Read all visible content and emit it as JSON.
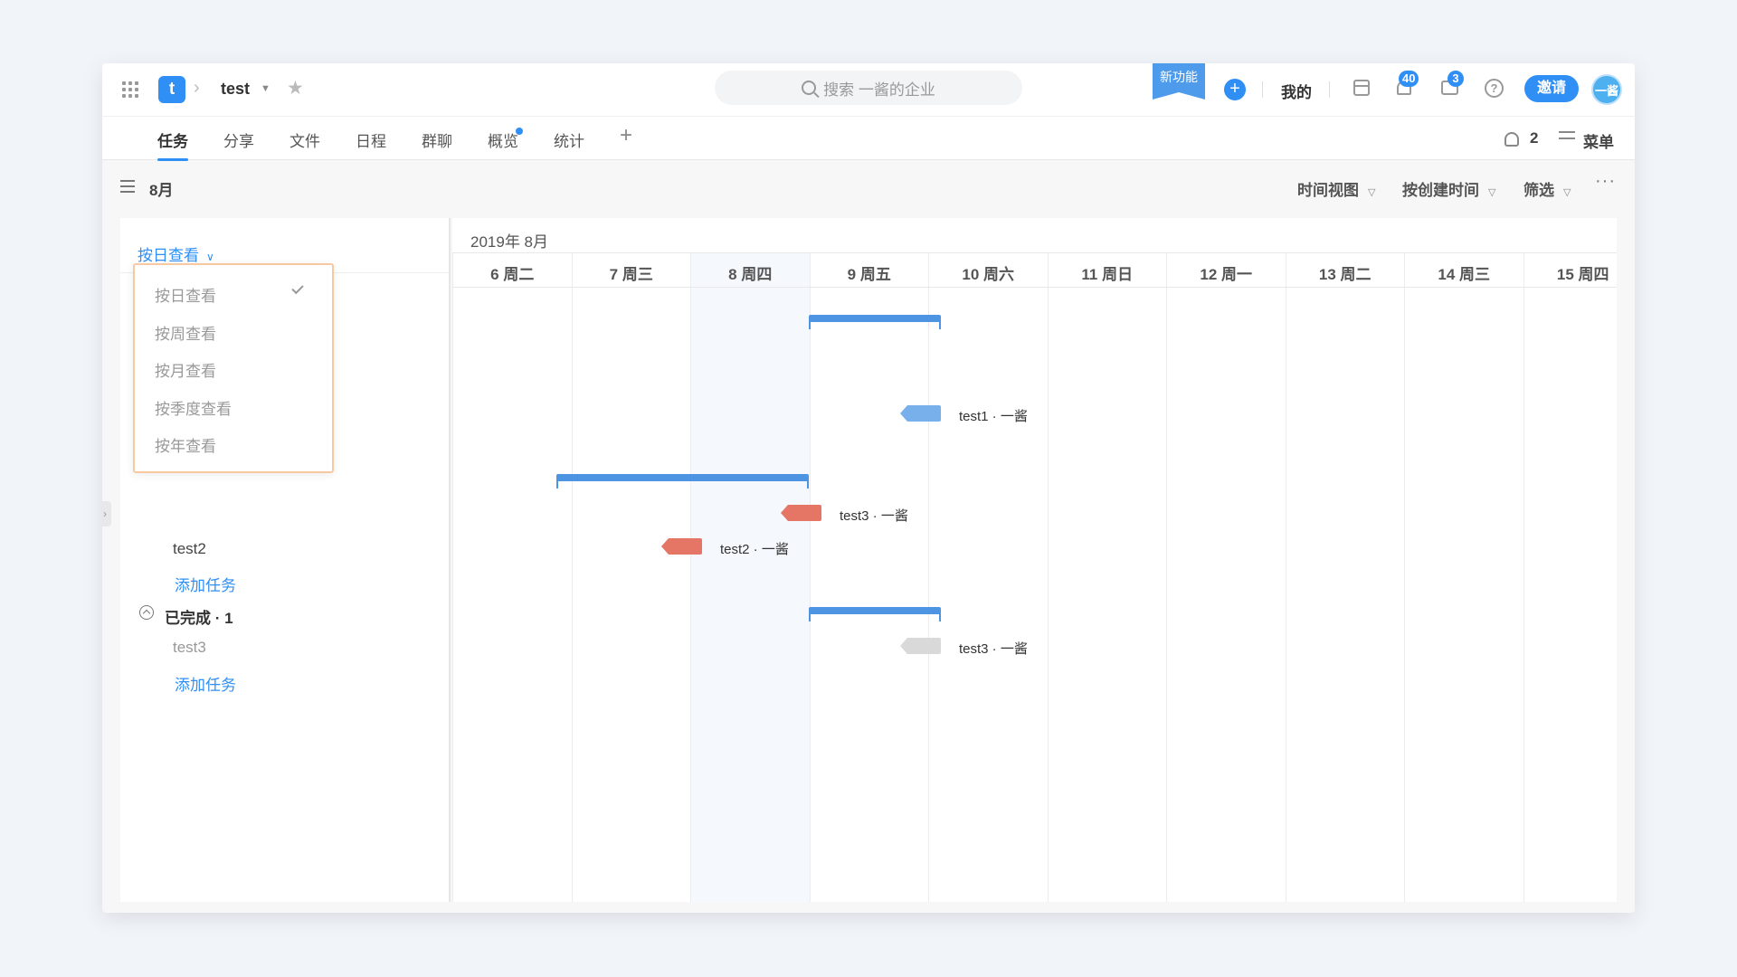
{
  "header": {
    "project_title": "test",
    "search_placeholder": "搜索 一酱的企业",
    "new_feature": "新功能",
    "mine": "我的",
    "bell_badge": "40",
    "msg_badge": "3",
    "help": "?",
    "invite": "邀请",
    "avatar": "一酱",
    "accent": "#2f8ff5"
  },
  "tabs": [
    {
      "label": "任务"
    },
    {
      "label": "分享"
    },
    {
      "label": "文件"
    },
    {
      "label": "日程"
    },
    {
      "label": "群聊"
    },
    {
      "label": "概览"
    },
    {
      "label": "统计"
    }
  ],
  "tab_right": {
    "member_count": "2",
    "menu": "菜单"
  },
  "toolbar": {
    "month": "8月",
    "time_view": "时间视图",
    "sort": "按创建时间",
    "filter": "筛选",
    "more": "···"
  },
  "left": {
    "view_toggle": "按日查看",
    "dropdown": [
      "按日查看",
      "按周查看",
      "按月查看",
      "按季度查看",
      "按年查看"
    ],
    "task_test2": "test2",
    "add_task_1": "添加任务",
    "done_group": "已完成 · 1",
    "task_test3": "test3",
    "add_task_2": "添加任务"
  },
  "gantt": {
    "month": "2019年 8月",
    "days": [
      "6 周二",
      "7 周三",
      "8 周四",
      "9 周五",
      "10 周六",
      "11 周日",
      "12 周一",
      "13 周二",
      "14 周三",
      "15 周四"
    ],
    "bars": [
      {
        "label": "test1 · 一酱",
        "color": "#78b0ec"
      },
      {
        "label": "test3 · 一酱",
        "color": "#e57565"
      },
      {
        "label": "test2 · 一酱",
        "color": "#e57565"
      },
      {
        "label": "test3 · 一酱",
        "color": "#d9d9d9"
      }
    ]
  }
}
